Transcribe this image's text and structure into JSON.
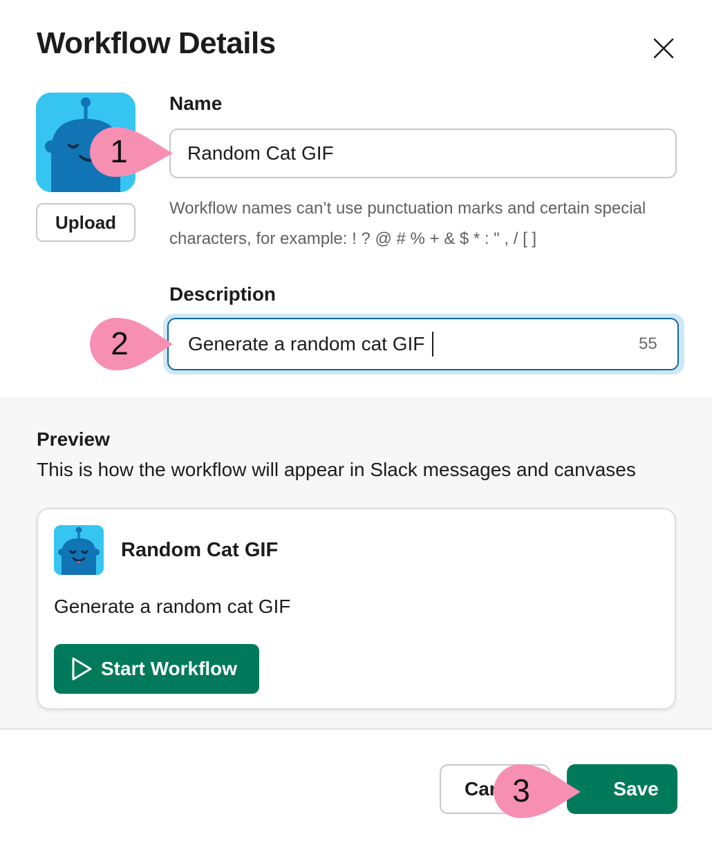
{
  "header": {
    "title": "Workflow Details",
    "close_icon": "close-icon"
  },
  "avatar": {
    "icon": "robot-avatar-icon",
    "upload_label": "Upload"
  },
  "form": {
    "name_label": "Name",
    "name_value": "Random Cat GIF",
    "name_hint": "Workflow names can’t use punctuation marks and certain special characters, for example: ! ? @ # % + & $ * : \" , / [ ]",
    "description_label": "Description",
    "description_value": "Generate a random cat GIF",
    "description_counter": "55"
  },
  "preview": {
    "title": "Preview",
    "subtitle": "This is how the workflow will appear in Slack messages and canvases",
    "card_name": "Random Cat GIF",
    "card_description": "Generate a random cat GIF",
    "start_label": "Start Workflow",
    "start_icon": "play-icon"
  },
  "footer": {
    "cancel_label": "Cancel",
    "save_label": "Save"
  },
  "callouts": [
    "1",
    "2",
    "3"
  ],
  "colors": {
    "accent_green": "#007a5a",
    "avatar_bg": "#36c5f0",
    "focus_blue": "#1264a3",
    "callout_pink": "#f78fb3"
  }
}
